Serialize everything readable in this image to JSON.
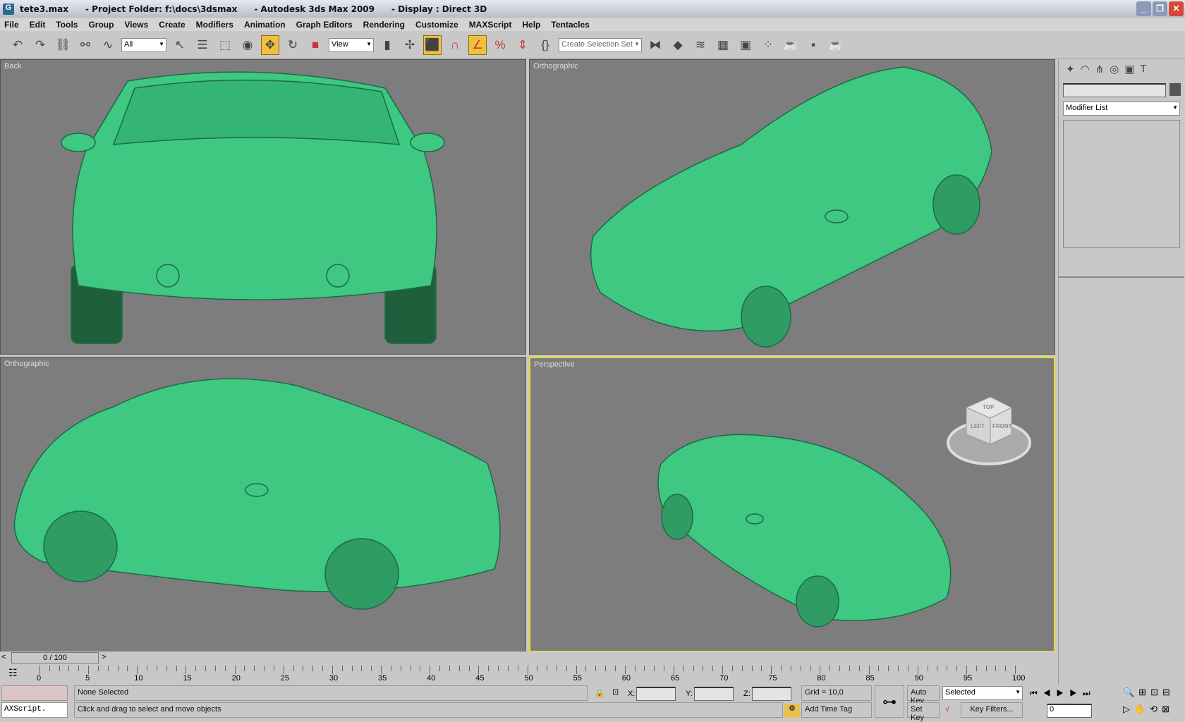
{
  "title": {
    "file": "tete3.max",
    "project": "- Project Folder: f:\\docs\\3dsmax",
    "app": "- Autodesk 3ds Max  2009",
    "display": "- Display : Direct 3D"
  },
  "menu": [
    "File",
    "Edit",
    "Tools",
    "Group",
    "Views",
    "Create",
    "Modifiers",
    "Animation",
    "Graph Editors",
    "Rendering",
    "Customize",
    "MAXScript",
    "Help",
    "Tentacles"
  ],
  "toolbar": {
    "filter": "All",
    "coord": "View",
    "selection_set": "Create Selection Set"
  },
  "viewports": [
    {
      "label": "Back"
    },
    {
      "label": "Orthographic"
    },
    {
      "label": "Orthographic"
    },
    {
      "label": "Perspective",
      "active": true
    }
  ],
  "viewcube": {
    "top": "TOP",
    "left": "LEFT",
    "front": "FRONT"
  },
  "command_panel": {
    "modifier_list": "Modifier List"
  },
  "time_slider": {
    "value": "0 / 100"
  },
  "ticks": [
    0,
    5,
    10,
    15,
    20,
    25,
    30,
    35,
    40,
    45,
    50,
    55,
    60,
    65,
    70,
    75,
    80,
    85,
    90,
    95,
    100
  ],
  "status": {
    "selection": "None Selected",
    "prompt": "Click and drag to select and move objects",
    "listener": "AXScript.",
    "x_label": "X:",
    "y_label": "Y:",
    "z_label": "Z:",
    "grid": "Grid = 10,0",
    "add_time_tag": "Add Time Tag",
    "auto_key": "Auto Key",
    "set_key": "Set Key",
    "key_mode": "Selected",
    "key_filters": "Key Filters...",
    "frame": "0"
  },
  "colors": {
    "car": "#3ec882",
    "viewport": "#7d7d7d",
    "active_border": "#f0e020"
  }
}
